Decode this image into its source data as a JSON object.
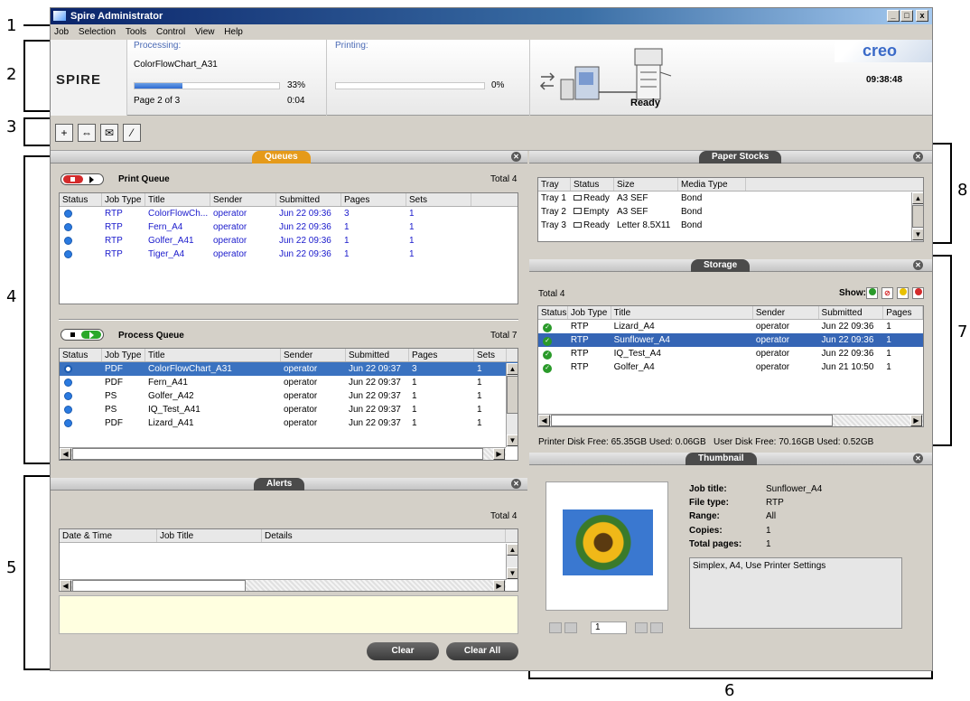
{
  "callouts": [
    "1",
    "2",
    "3",
    "4",
    "5",
    "6",
    "7",
    "8"
  ],
  "window": {
    "title": "Spire Administrator",
    "buttons": [
      "_",
      "□",
      "x"
    ]
  },
  "menu": [
    "Job",
    "Selection",
    "Tools",
    "Control",
    "View",
    "Help"
  ],
  "status": {
    "logo": "SPIRE",
    "processing_label": "Processing:",
    "processing_job": "ColorFlowChart_A31",
    "processing_percent": "33%",
    "processing_progress": 0.33,
    "page": "Page 2 of 3",
    "elapsed": "0:04",
    "printing_label": "Printing:",
    "printing_percent": "0%",
    "printing_progress": 0,
    "brand": "creo",
    "clock": "09:38:48",
    "printer_status": "Ready"
  },
  "toolbar": {
    "icons": [
      "import-job-icon",
      "virtual-printer-icon",
      "message-icon",
      "calibration-icon"
    ]
  },
  "queues": {
    "tab": "Queues",
    "print_queue": {
      "title": "Print Queue",
      "total": "Total 4",
      "columns": [
        "Status",
        "Job Type",
        "Title",
        "Sender",
        "Submitted",
        "Pages",
        "Sets"
      ],
      "rows": [
        [
          "RTP",
          "ColorFlowCh...",
          "operator",
          "Jun 22 09:36",
          "3",
          "1"
        ],
        [
          "RTP",
          "Fern_A4",
          "operator",
          "Jun 22 09:36",
          "1",
          "1"
        ],
        [
          "RTP",
          "Golfer_A41",
          "operator",
          "Jun 22 09:36",
          "1",
          "1"
        ],
        [
          "RTP",
          "Tiger_A4",
          "operator",
          "Jun 22 09:36",
          "1",
          "1"
        ]
      ]
    },
    "process_queue": {
      "title": "Process Queue",
      "total": "Total 7",
      "columns": [
        "Status",
        "Job Type",
        "Title",
        "Sender",
        "Submitted",
        "Pages",
        "Sets"
      ],
      "rows": [
        [
          "PDF",
          "ColorFlowChart_A31",
          "operator",
          "Jun 22 09:37",
          "3",
          "1"
        ],
        [
          "PDF",
          "Fern_A41",
          "operator",
          "Jun 22 09:37",
          "1",
          "1"
        ],
        [
          "PS",
          "Golfer_A42",
          "operator",
          "Jun 22 09:37",
          "1",
          "1"
        ],
        [
          "PS",
          "IQ_Test_A41",
          "operator",
          "Jun 22 09:37",
          "1",
          "1"
        ],
        [
          "PDF",
          "Lizard_A41",
          "operator",
          "Jun 22 09:37",
          "1",
          "1"
        ]
      ]
    }
  },
  "alerts": {
    "tab": "Alerts",
    "total": "Total 4",
    "columns": [
      "Date & Time",
      "Job Title",
      "Details"
    ],
    "clear": "Clear",
    "clear_all": "Clear All"
  },
  "paper_stocks": {
    "tab": "Paper Stocks",
    "columns": [
      "Tray",
      "Status",
      "Size",
      "Media Type"
    ],
    "rows": [
      [
        "Tray 1",
        "Ready",
        "A3 SEF",
        "Bond"
      ],
      [
        "Tray 2",
        "Empty",
        "A3 SEF",
        "Bond"
      ],
      [
        "Tray 3",
        "Ready",
        "Letter 8.5X11",
        "Bond"
      ]
    ]
  },
  "storage": {
    "tab": "Storage",
    "total": "Total 4",
    "show_label": "Show:",
    "columns": [
      "Status",
      "Job Type",
      "Title",
      "Sender",
      "Submitted",
      "Pages"
    ],
    "rows": [
      [
        "RTP",
        "Lizard_A4",
        "operator",
        "Jun 22 09:36",
        "1"
      ],
      [
        "RTP",
        "Sunflower_A4",
        "operator",
        "Jun 22 09:36",
        "1"
      ],
      [
        "RTP",
        "IQ_Test_A4",
        "operator",
        "Jun 22 09:36",
        "1"
      ],
      [
        "RTP",
        "Golfer_A4",
        "operator",
        "Jun 21 10:50",
        "1"
      ]
    ],
    "disk_info": "Printer Disk Free: 65.35GB Used: 0.06GB   User Disk Free: 70.16GB Used: 0.52GB"
  },
  "thumbnail": {
    "tab": "Thumbnail",
    "fields": [
      [
        "Job title:",
        "Sunflower_A4"
      ],
      [
        "File type:",
        "RTP"
      ],
      [
        "Range:",
        "All"
      ],
      [
        "Copies:",
        "1"
      ],
      [
        "Total pages:",
        "1"
      ]
    ],
    "notes": "Simplex, A4, Use Printer Settings",
    "page_number": "1"
  }
}
